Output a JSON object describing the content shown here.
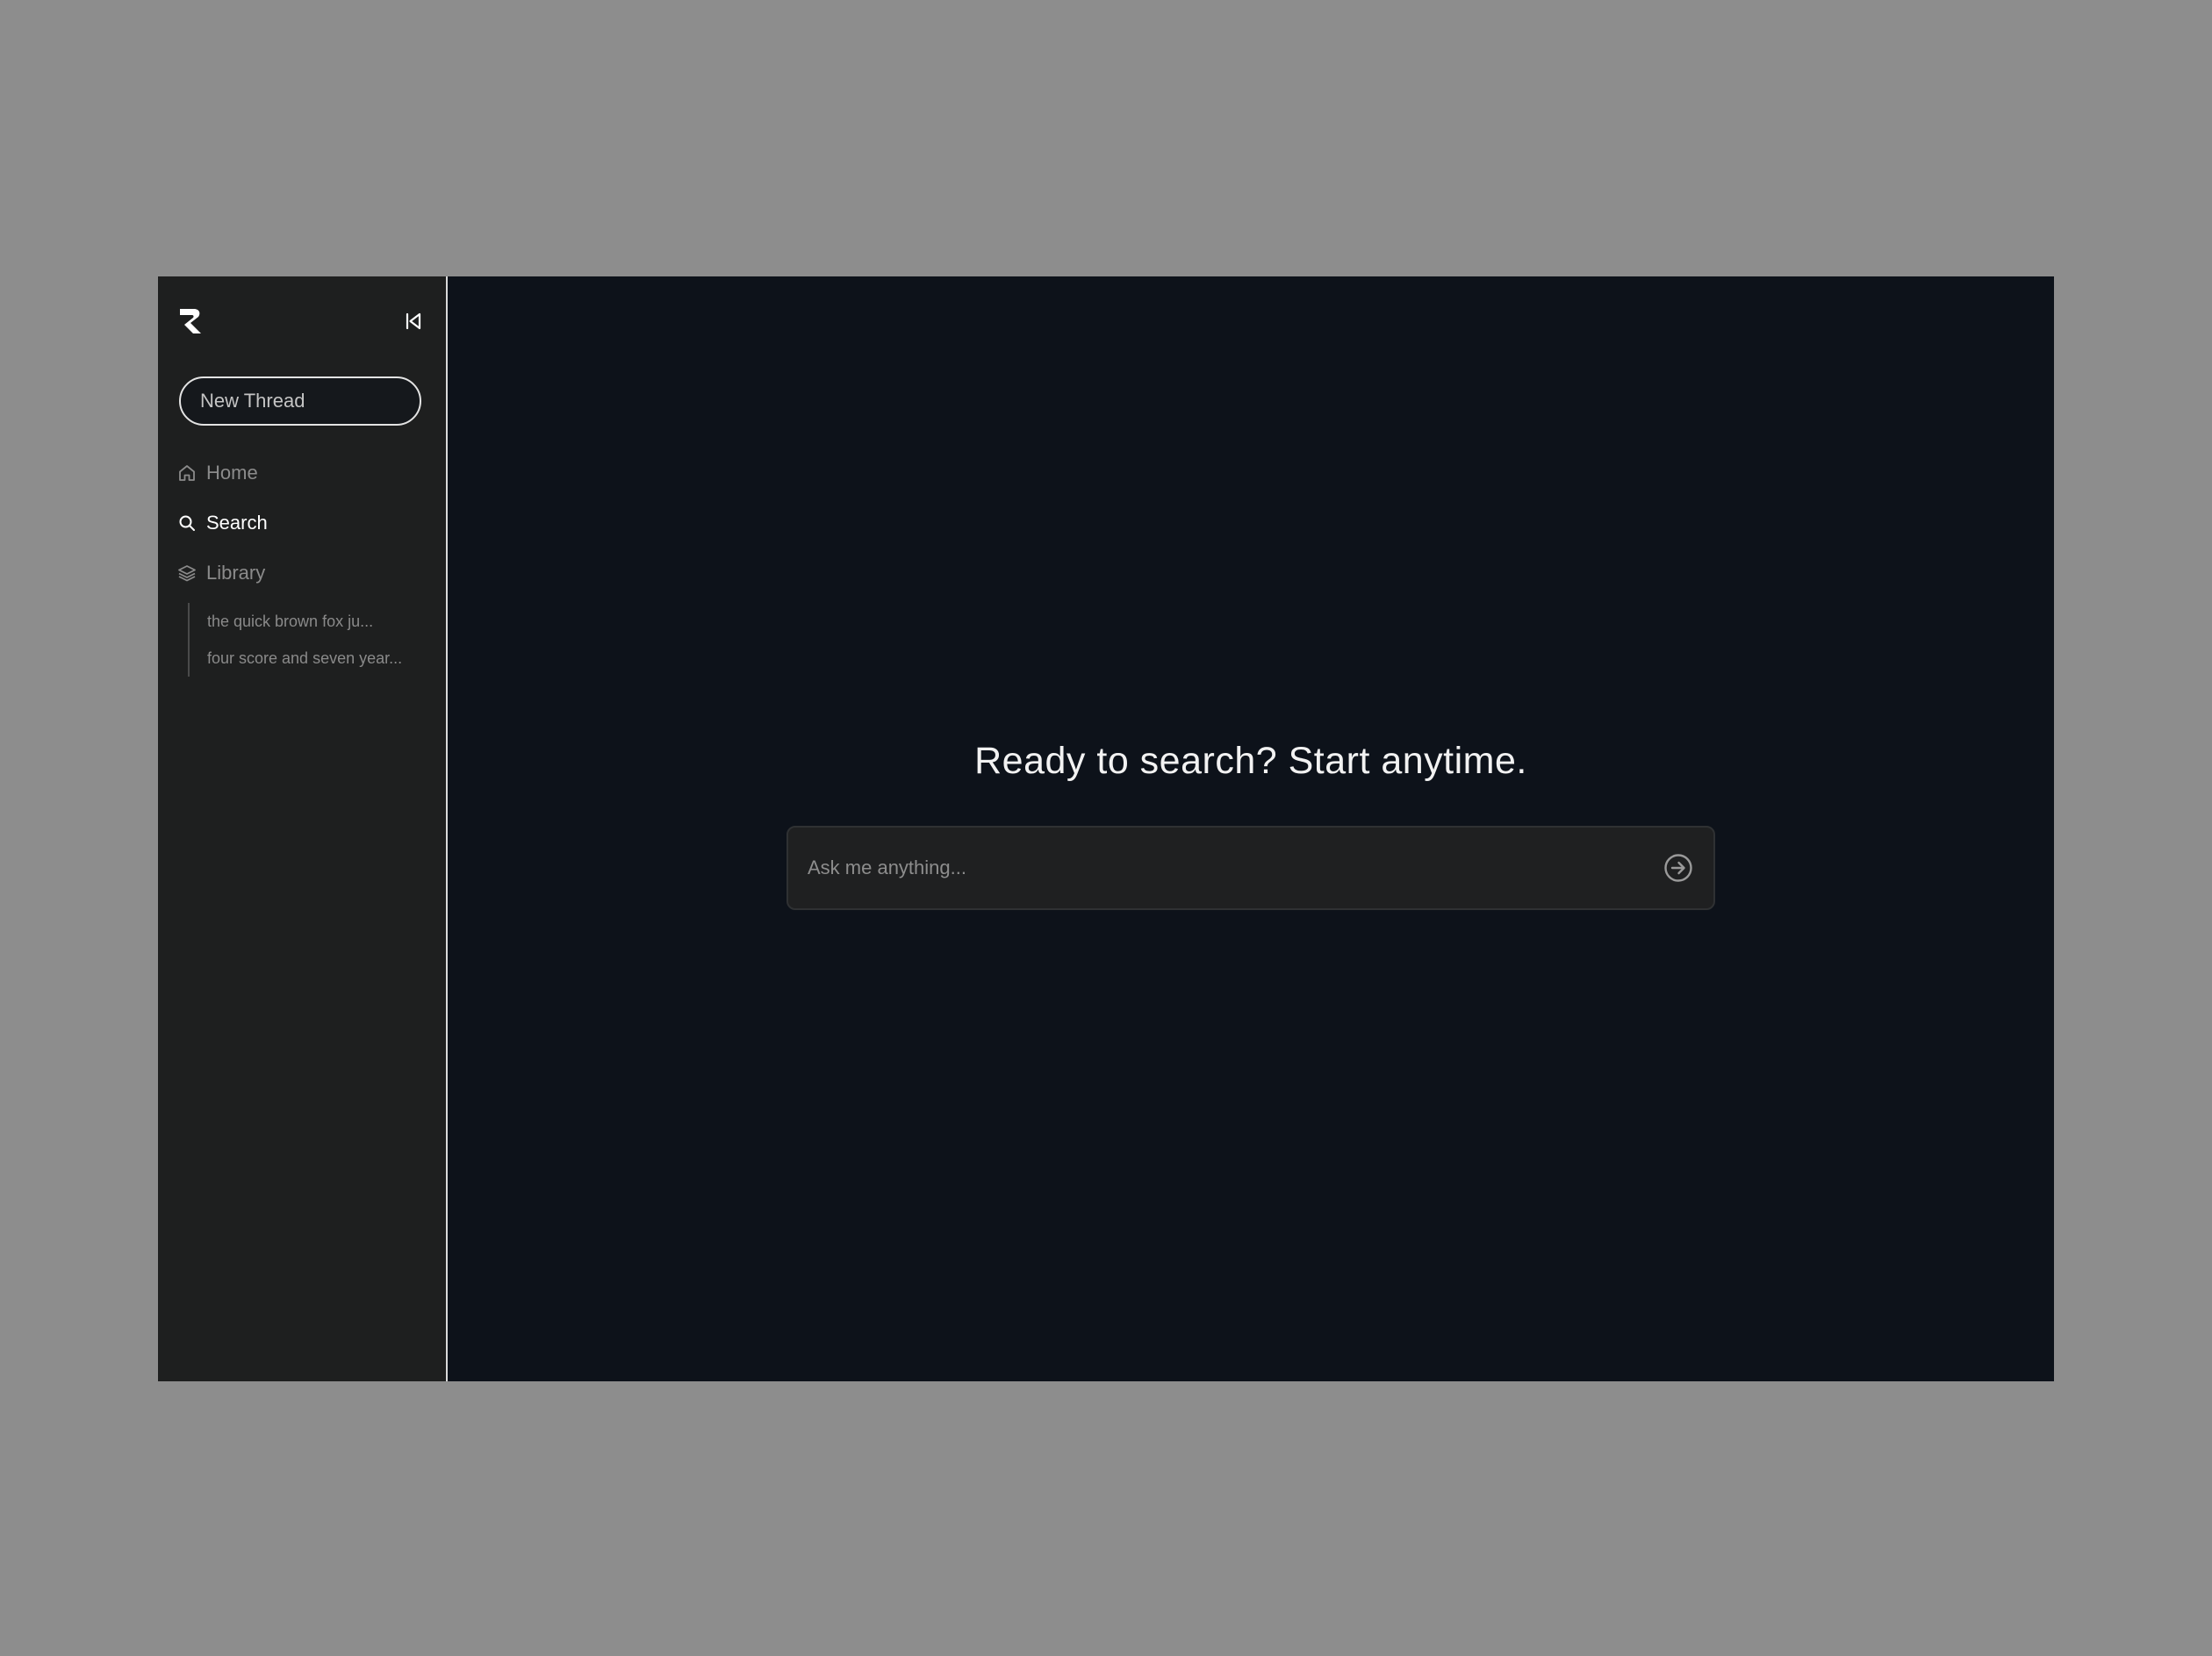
{
  "sidebar": {
    "logo_icon": "r-logo-icon",
    "collapse_icon": "collapse-sidebar-icon",
    "new_thread_label": "New Thread",
    "nav": [
      {
        "label": "Home",
        "icon": "home-icon",
        "active": false
      },
      {
        "label": "Search",
        "icon": "search-icon",
        "active": true
      },
      {
        "label": "Library",
        "icon": "layers-icon",
        "active": false
      }
    ],
    "library_items": [
      "the quick brown fox ju...",
      "four score and seven year..."
    ]
  },
  "main": {
    "title": "Ready to search? Start anytime.",
    "search": {
      "placeholder": "Ask me anything...",
      "value": "",
      "submit_icon": "arrow-right-circle-icon"
    }
  },
  "colors": {
    "backdrop": "#8d8d8d",
    "sidebar_bg": "#1e1f1f",
    "main_bg": "#0d121a",
    "search_bg": "#1f2021",
    "active_text": "#ffffff",
    "muted_text": "#8b8b8b"
  }
}
